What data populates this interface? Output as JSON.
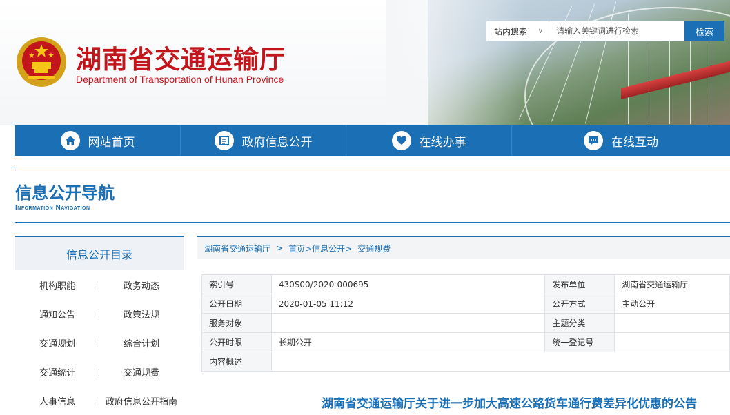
{
  "header": {
    "site_name_cn": "湖南省交通运输厅",
    "site_name_en": "Department of Transportation of Hunan Province",
    "emblem_icon": "national-emblem-icon",
    "search": {
      "scope_label": "站内搜索",
      "scope_caret": "∨",
      "placeholder": "请输入关键词进行检索",
      "button_label": "检索"
    }
  },
  "nav": {
    "items": [
      {
        "label": "网站首页",
        "icon": "home-icon"
      },
      {
        "label": "政府信息公开",
        "icon": "document-icon"
      },
      {
        "label": "在线办事",
        "icon": "service-icon"
      },
      {
        "label": "在线互动",
        "icon": "chat-icon"
      }
    ]
  },
  "section": {
    "title_cn": "信息公开导航",
    "title_en": "Information Navigation"
  },
  "sidebar": {
    "title": "信息公开目录",
    "items": [
      "机构职能",
      "政务动态",
      "通知公告",
      "政策法规",
      "交通规划",
      "综合计划",
      "交通统计",
      "交通规费",
      "人事信息",
      "政府信息公开指南"
    ]
  },
  "breadcrumb": {
    "items": [
      "湖南省交通运输厅",
      ">",
      "首页>信息公开>",
      "交通规费"
    ]
  },
  "info_table": {
    "rows": [
      [
        "索引号",
        "430S00/2020-000695",
        "发布单位",
        "湖南省交通运输厅"
      ],
      [
        "公开日期",
        "2020-01-05 11:12",
        "公开方式",
        "主动公开"
      ],
      [
        "服务对象",
        "",
        "主题分类",
        ""
      ],
      [
        "公开时限",
        "长期公开",
        "统一登记号",
        ""
      ],
      [
        "内容概述",
        "",
        "",
        ""
      ]
    ]
  },
  "document": {
    "title": "湖南省交通运输厅关于进一步加大高速公路货车通行费差异化优惠的公告"
  },
  "colors": {
    "brand_blue": "#1a6fb5",
    "brand_red": "#c3161c"
  }
}
